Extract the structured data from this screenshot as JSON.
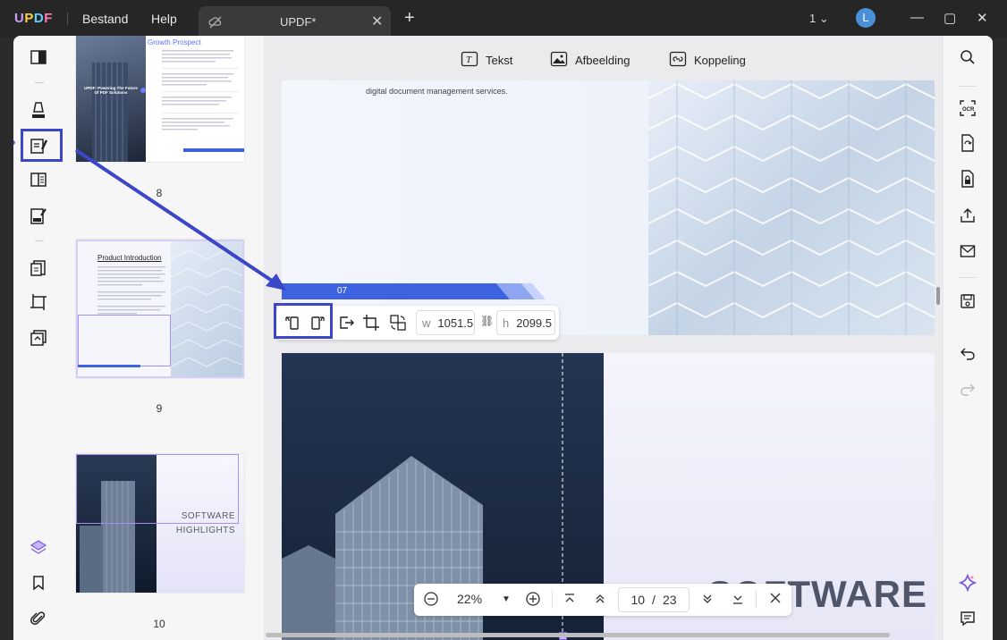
{
  "titlebar": {
    "logo": "UPDF",
    "menu": [
      "Bestand",
      "Help"
    ],
    "tab_title": "UPDF*",
    "page_indicator": "1",
    "avatar_letter": "L"
  },
  "subtoolbar": {
    "items": [
      {
        "label": "Tekst",
        "icon": "text-box-icon"
      },
      {
        "label": "Afbeelding",
        "icon": "image-icon"
      },
      {
        "label": "Koppeling",
        "icon": "link-icon"
      }
    ]
  },
  "thumbnails": [
    {
      "page": "8",
      "heading": "Growth Prospect",
      "image_title": "UPDF: Powering The Future Of PDF Solutions"
    },
    {
      "page": "9",
      "heading": "Product Introduction"
    },
    {
      "page": "10",
      "heading": "SOFTWARE HIGHLIGHTS"
    }
  ],
  "page1": {
    "text": "digital document management services.",
    "banner_number": "07"
  },
  "page2": {
    "big_text": "SOFTWARE"
  },
  "image_toolbar": {
    "width_label": "w",
    "width_value": "1051.5",
    "height_label": "h",
    "height_value": "2099.5"
  },
  "zoom_bar": {
    "zoom": "22%",
    "current_page": "10",
    "separator": "/",
    "total_pages": "23"
  },
  "colors": {
    "accent": "#3b46c9",
    "banner_blue": "#3d63e0",
    "titlebar_bg": "#262626"
  }
}
